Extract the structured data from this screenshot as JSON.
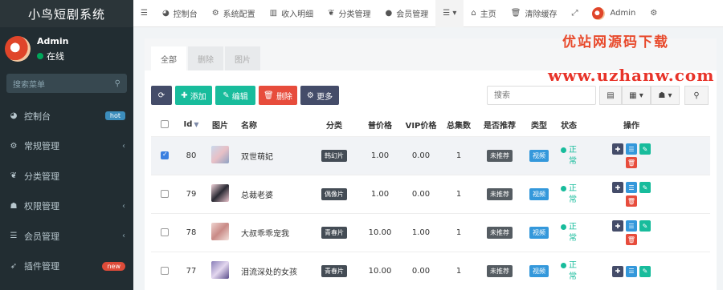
{
  "brand": "小鸟短剧系统",
  "user": {
    "name": "Admin",
    "status": "在线"
  },
  "sidebar": {
    "search_placeholder": "搜索菜单",
    "items": [
      {
        "label": "控制台",
        "badge": "hot",
        "icon": "dashboard-icon"
      },
      {
        "label": "常规管理",
        "icon": "gears-icon"
      },
      {
        "label": "分类管理",
        "icon": "leaf-icon"
      },
      {
        "label": "权限管理",
        "icon": "group-icon"
      },
      {
        "label": "会员管理",
        "icon": "list-icon"
      },
      {
        "label": "插件管理",
        "badge": "new",
        "icon": "rocket-icon"
      }
    ]
  },
  "topbar": {
    "tabs": [
      "控制台",
      "系统配置",
      "收入明细",
      "分类管理",
      "会员管理"
    ],
    "home": "主页",
    "clear_cache": "清除缓存",
    "user": "Admin"
  },
  "watermark": {
    "line1": "优站网源码下载",
    "line2": "www.uzhanw.com"
  },
  "content_tabs": [
    "全部",
    "删除",
    "图片"
  ],
  "toolbar": {
    "add": "添加",
    "edit": "编辑",
    "delete": "删除",
    "more": "更多",
    "search_placeholder": "搜索"
  },
  "table": {
    "headers": {
      "id": "Id",
      "image": "图片",
      "name": "名称",
      "category": "分类",
      "price": "普价格",
      "vip_price": "VIP价格",
      "episodes": "总集数",
      "recommend": "是否推荐",
      "type": "类型",
      "status": "状态",
      "ops": "操作"
    },
    "rows": [
      {
        "id": "80",
        "name": "双世萌妃",
        "category": "韩幻片",
        "price": "1.00",
        "vip_price": "0.00",
        "episodes": "1",
        "recommend": "未推荐",
        "type": "视频",
        "status": "正常",
        "checked": true
      },
      {
        "id": "79",
        "name": "总裁老婆",
        "category": "偶像片",
        "price": "1.00",
        "vip_price": "0.00",
        "episodes": "1",
        "recommend": "未推荐",
        "type": "视频",
        "status": "正常",
        "checked": false
      },
      {
        "id": "78",
        "name": "大叔乖乖宠我",
        "category": "青春片",
        "price": "10.00",
        "vip_price": "1.00",
        "episodes": "1",
        "recommend": "未推荐",
        "type": "视频",
        "status": "正常",
        "checked": false
      },
      {
        "id": "77",
        "name": "泪流深处的女孩",
        "category": "青春片",
        "price": "10.00",
        "vip_price": "0.00",
        "episodes": "1",
        "recommend": "未推荐",
        "type": "视频",
        "status": "正常",
        "checked": false
      }
    ]
  },
  "colors": {
    "sidebar": "#222d32",
    "accent_green": "#18bc9c",
    "accent_blue": "#3498db",
    "accent_red": "#e74c3c",
    "navy": "#444c69"
  }
}
